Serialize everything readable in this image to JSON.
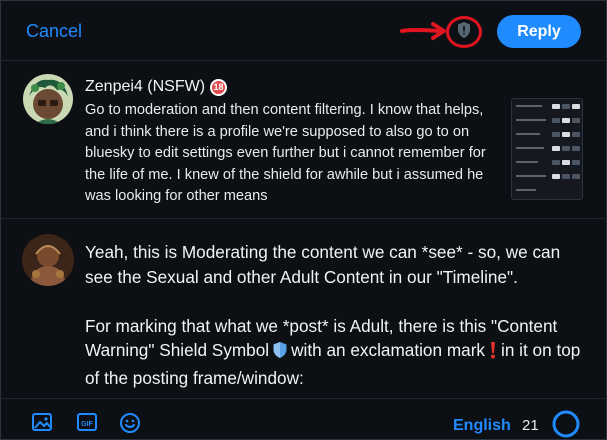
{
  "header": {
    "cancel_label": "Cancel",
    "reply_label": "Reply",
    "shield_icon": "shield-icon",
    "annotation": "red-arrow-circle-around-shield"
  },
  "quoted_post": {
    "author": "Zenpei4 (NSFW)",
    "badge": "18",
    "text": "Go to moderation and then content filtering. I know that helps, and i think there is a profile we're supposed to also go to on bluesky to edit settings even further but i cannot remember for the life of me. I knew of the shield for awhile but i assumed he was looking for other means",
    "attachment": "screenshot-thumbnail"
  },
  "composer": {
    "para1": "Yeah, this is Moderating the content we can *see* - so, we can see the Sexual and other Adult Content in our \"Timeline\".",
    "para2_a": "For marking that what we *post* is Adult, there is this \"Content Warning\" Shield Symbol",
    "para2_b": "with an exclamation mark",
    "para2_c": "in it on top of the posting frame/window:"
  },
  "toolbar": {
    "icons": [
      "image-icon",
      "gif-icon",
      "emoji-icon"
    ],
    "language": "English",
    "char_count": "21"
  },
  "colors": {
    "background": "#0c0f14",
    "accent": "#208bfe",
    "annotation_red": "#e0151f"
  }
}
